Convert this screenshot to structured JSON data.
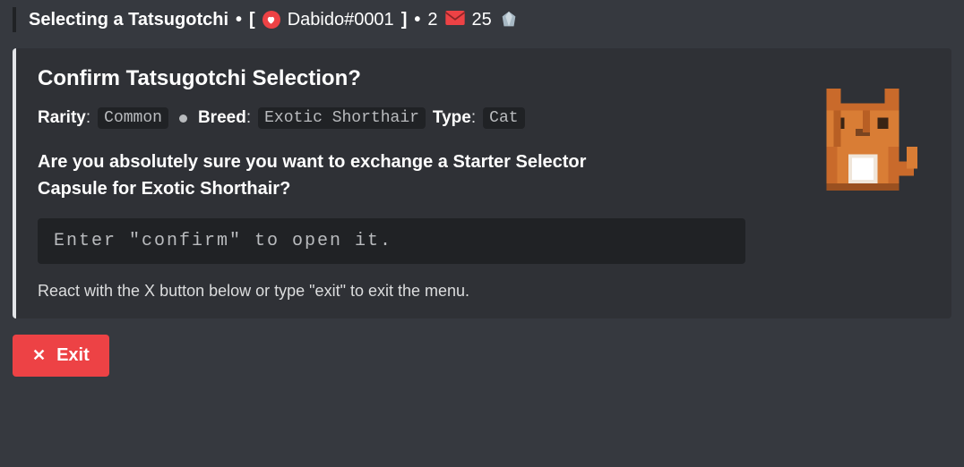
{
  "header": {
    "title": "Selecting a Tatsugotchi",
    "username": "Dabido#0001",
    "count1": "2",
    "count2": "25"
  },
  "embed": {
    "title": "Confirm Tatsugotchi Selection?",
    "rarity_label": "Rarity",
    "rarity_value": "Common",
    "breed_label": "Breed",
    "breed_value": "Exotic Shorthair",
    "type_label": "Type",
    "type_value": "Cat",
    "confirm_prefix": "Are you absolutely sure you want to exchange a ",
    "confirm_item": "Starter Selector Capsule",
    "confirm_mid": " for ",
    "confirm_target": "Exotic Shorthair",
    "confirm_suffix": "?",
    "code_instruction": "Enter \"confirm\" to open it.",
    "footer": "React with the X button below or type \"exit\" to exit the menu."
  },
  "exit_button": {
    "label": "Exit"
  }
}
